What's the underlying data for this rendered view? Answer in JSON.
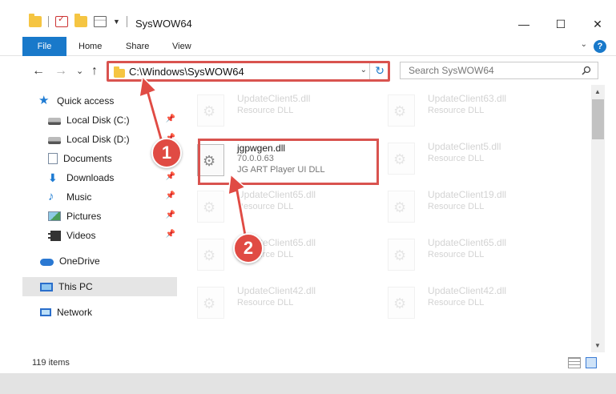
{
  "window": {
    "title": "SysWOW64",
    "controls": {
      "minimize": "—",
      "maximize": "☐",
      "close": "✕"
    }
  },
  "ribbon": {
    "file": "File",
    "tabs": [
      "Home",
      "Share",
      "View"
    ],
    "help": "?"
  },
  "navbar": {
    "back": "←",
    "forward": "→",
    "recent": "⌄",
    "up": "↑",
    "address": "C:\\Windows\\SysWOW64",
    "search_placeholder": "Search SysWOW64"
  },
  "sidebar": {
    "items": [
      {
        "label": "Quick access",
        "icon": "star-icon",
        "pinned": false
      },
      {
        "label": "Local Disk (C:)",
        "icon": "disk-icon",
        "pinned": true
      },
      {
        "label": "Local Disk (D:)",
        "icon": "disk-icon",
        "pinned": true
      },
      {
        "label": "Documents",
        "icon": "documents-icon",
        "pinned": true
      },
      {
        "label": "Downloads",
        "icon": "download-icon",
        "pinned": true
      },
      {
        "label": "Music",
        "icon": "music-icon",
        "pinned": true
      },
      {
        "label": "Pictures",
        "icon": "pictures-icon",
        "pinned": true
      },
      {
        "label": "Videos",
        "icon": "videos-icon",
        "pinned": true
      },
      {
        "label": "OneDrive",
        "icon": "onedrive-icon",
        "pinned": false
      },
      {
        "label": "This PC",
        "icon": "pc-icon",
        "pinned": false,
        "selected": true
      },
      {
        "label": "Network",
        "icon": "network-icon",
        "pinned": false
      }
    ]
  },
  "files": {
    "left": [
      {
        "name": "UpdateClient5.dll",
        "desc": "Resource DLL"
      },
      {
        "name": "jgpwgen.dll",
        "version": "70.0.0.63",
        "desc": "JG ART Player UI DLL"
      },
      {
        "name": "UpdateClient65.dll",
        "desc": "Resource DLL"
      },
      {
        "name": "UpdateClient65.dll",
        "desc": "Resource DLL"
      },
      {
        "name": "UpdateClient42.dll",
        "desc": "Resource DLL"
      }
    ],
    "right": [
      {
        "name": "UpdateClient63.dll",
        "desc": "Resource DLL"
      },
      {
        "name": "UpdateClient5.dll",
        "desc": "Resource DLL"
      },
      {
        "name": "UpdateClient19.dll",
        "desc": "Resource DLL"
      },
      {
        "name": "UpdateClient65.dll",
        "desc": "Resource DLL"
      },
      {
        "name": "UpdateClient42.dll",
        "desc": "Resource DLL"
      }
    ]
  },
  "status": {
    "item_count": "119 items"
  },
  "annotations": {
    "badge1": "1",
    "badge2": "2",
    "color": "#e04b44"
  }
}
